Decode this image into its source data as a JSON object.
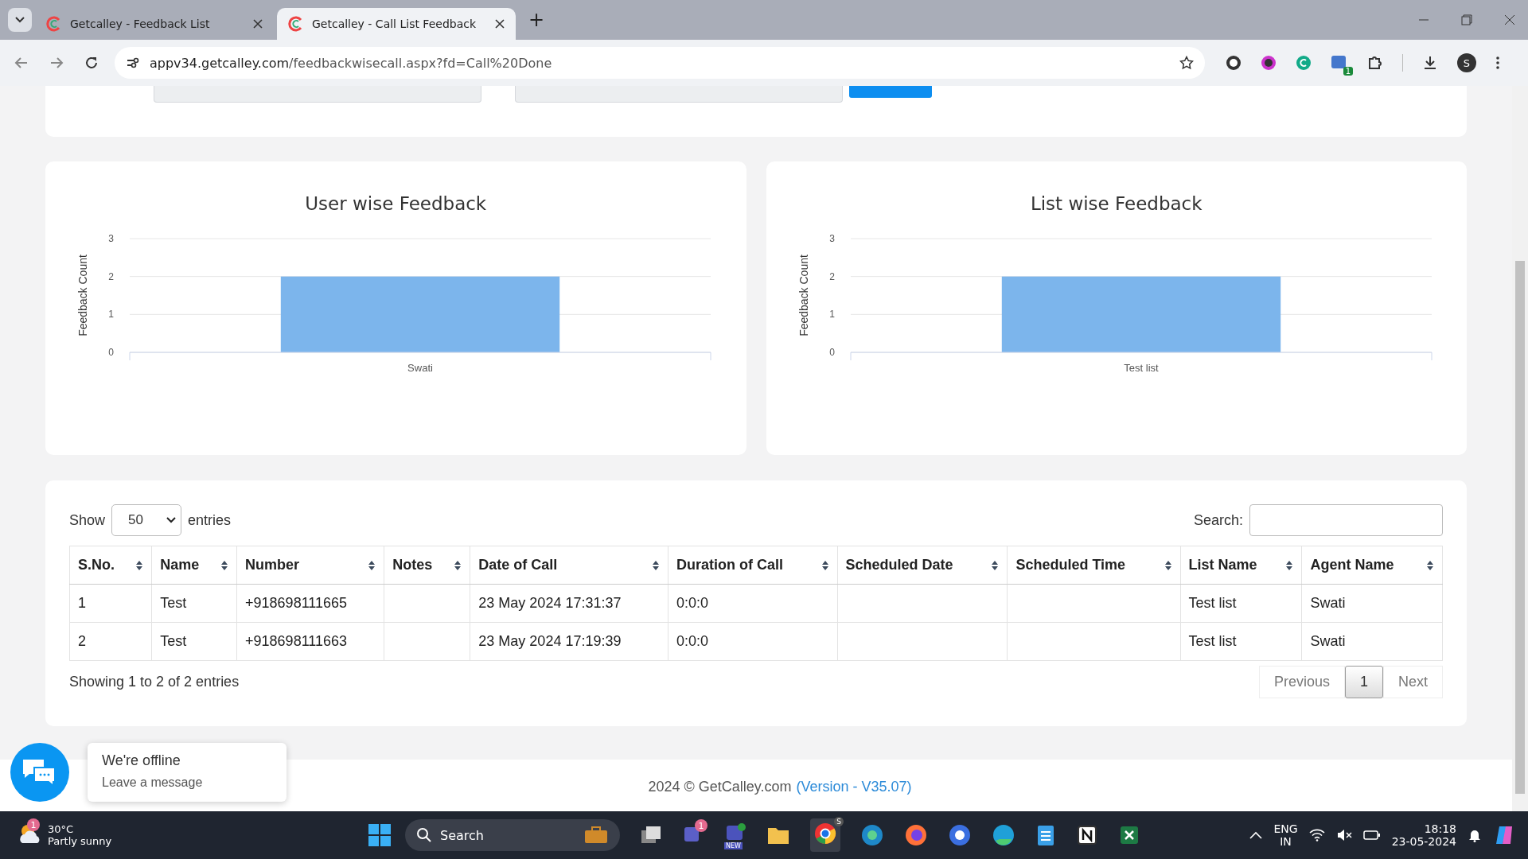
{
  "browser": {
    "tabs": [
      {
        "title": "Getcalley - Feedback List",
        "selected": false
      },
      {
        "title": "Getcalley - Call List Feedback",
        "selected": true
      }
    ],
    "new_tab": "+",
    "url_host": "appv34.getcalley.com",
    "url_path": "/feedbackwisecall.aspx?fd=Call%20Done",
    "extension_badge": "1",
    "profile": "S"
  },
  "charts": [
    {
      "chart_data": {
        "type": "bar",
        "title": "User wise Feedback",
        "ylabel": "Feedback Count",
        "categories": [
          "Swati"
        ],
        "series": [
          {
            "color": "#7cb5ec",
            "values": [
              2
            ]
          }
        ],
        "ylim": [
          0,
          3
        ],
        "yticks": [
          0,
          1,
          2,
          3
        ]
      }
    },
    {
      "chart_data": {
        "type": "bar",
        "title": "List wise Feedback",
        "ylabel": "Feedback Count",
        "categories": [
          "Test list"
        ],
        "series": [
          {
            "color": "#7cb5ec",
            "values": [
              2
            ]
          }
        ],
        "ylim": [
          0,
          3
        ],
        "yticks": [
          0,
          1,
          2,
          3
        ]
      }
    }
  ],
  "table": {
    "show_label": "Show",
    "page_size": "50",
    "entries_label": "entries",
    "search_label": "Search:",
    "columns": [
      "S.No.",
      "Name",
      "Number",
      "Notes",
      "Date of Call",
      "Duration of Call",
      "Scheduled Date",
      "Scheduled Time",
      "List Name",
      "Agent Name"
    ],
    "rows": [
      [
        "1",
        "Test",
        "+918698111665",
        "",
        "23 May 2024 17:31:37",
        "0:0:0",
        "",
        "",
        "Test list",
        "Swati"
      ],
      [
        "2",
        "Test",
        "+918698111663",
        "",
        "23 May 2024 17:19:39",
        "0:0:0",
        "",
        "",
        "Test list",
        "Swati"
      ]
    ],
    "info": "Showing 1 to 2 of 2 entries",
    "pagination": [
      {
        "label": "Previous",
        "selected": false
      },
      {
        "label": "1",
        "selected": true
      },
      {
        "label": "Next",
        "selected": false
      }
    ]
  },
  "chat": {
    "title": "We're offline",
    "subtitle": "Leave a message"
  },
  "footer": {
    "text": "2024 © GetCalley.com",
    "link": "(Version - V35.07)"
  },
  "taskbar": {
    "temperature": "30°C",
    "weather": "Partly sunny",
    "weather_badge": "1",
    "search": "Search",
    "teams_badge": "1",
    "new_badge": "NEW",
    "chrome_badge": "S",
    "lang": "ENG",
    "region": "IN",
    "time": "18:18",
    "date": "23-05-2024"
  }
}
